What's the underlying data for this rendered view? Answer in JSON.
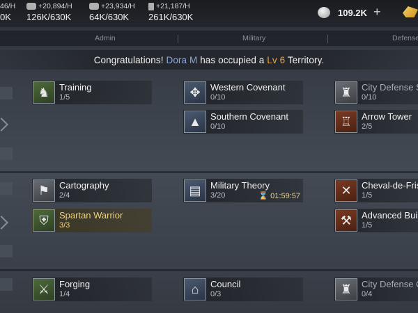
{
  "resources": [
    {
      "rate": "46/H",
      "amount": "0K"
    },
    {
      "rate": "+20,894/H",
      "amount": "126K/630K"
    },
    {
      "rate": "+23,934/H",
      "amount": "64K/630K"
    },
    {
      "rate": "+21,187/H",
      "amount": "261K/630K"
    }
  ],
  "silver": "109.2K",
  "plus": "+",
  "tabs": [
    "Admin",
    "Military",
    "Defense"
  ],
  "notice": {
    "pre": "Congratulations!",
    "name": "Dora M",
    "mid": "has occupied a",
    "lv": "Lv 6",
    "post": "Territory."
  },
  "cards": {
    "training": {
      "title": "Training",
      "progress": "1/5"
    },
    "western": {
      "title": "Western Covenant",
      "progress": "0/10"
    },
    "city_def_1": {
      "title": "City Defense S",
      "progress": "0/10"
    },
    "southern": {
      "title": "Southern Covenant",
      "progress": "0/10"
    },
    "arrow": {
      "title": "Arrow Tower",
      "progress": "2/5"
    },
    "cartography": {
      "title": "Cartography",
      "progress": "2/4"
    },
    "military_theory": {
      "title": "Military Theory",
      "progress": "3/20",
      "timer": "01:59:57"
    },
    "cheval": {
      "title": "Cheval-de-Fris",
      "progress": "1/5"
    },
    "spartan": {
      "title": "Spartan Warrior",
      "progress": "3/3"
    },
    "advanced": {
      "title": "Advanced Buil",
      "progress": "1/5"
    },
    "forging": {
      "title": "Forging",
      "progress": "1/4"
    },
    "council": {
      "title": "Council",
      "progress": "0/3"
    },
    "city_def_2": {
      "title": "City Defense C",
      "progress": "0/4"
    }
  },
  "icons": {
    "training": "soldier-training-icon",
    "western": "cross-emblem-icon",
    "city_def": "fortress-icon",
    "southern": "eye-pyramid-icon",
    "arrow": "tower-icon",
    "cartography": "map-scroll-icon",
    "military_theory": "book-scroll-icon",
    "cheval": "spikes-icon",
    "spartan": "spartan-shield-icon",
    "advanced": "builder-icon",
    "forging": "anvil-icon",
    "council": "council-hall-icon",
    "hourglass": "hourglass-icon"
  }
}
